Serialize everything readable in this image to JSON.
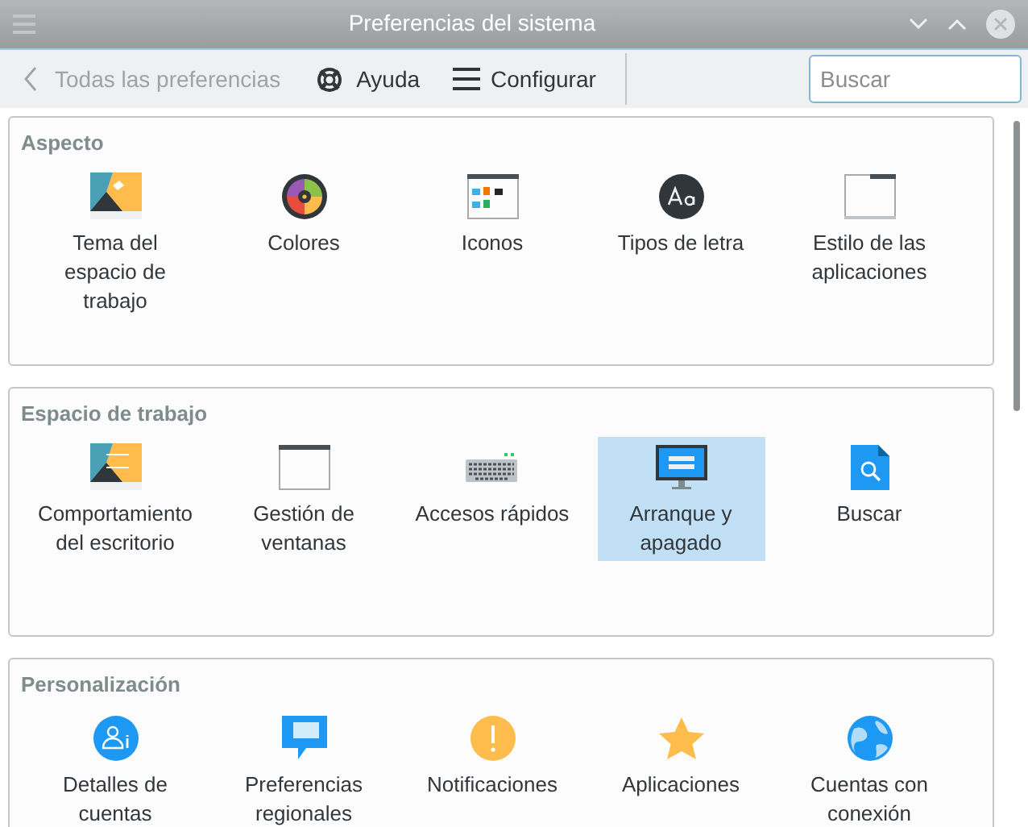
{
  "window": {
    "title": "Preferencias del sistema"
  },
  "toolbar": {
    "back": "Todas las preferencias",
    "help": "Ayuda",
    "configure": "Configurar"
  },
  "search": {
    "placeholder": "Buscar"
  },
  "sections": [
    {
      "title": "Aspecto",
      "items": [
        {
          "label": "Tema del espacio de trabajo",
          "selected": false
        },
        {
          "label": "Colores",
          "selected": false
        },
        {
          "label": "Iconos",
          "selected": false
        },
        {
          "label": "Tipos de letra",
          "selected": false
        },
        {
          "label": "Estilo de las aplicaciones",
          "selected": false
        }
      ]
    },
    {
      "title": "Espacio de trabajo",
      "items": [
        {
          "label": "Comportamiento del escritorio",
          "selected": false
        },
        {
          "label": "Gestión de ventanas",
          "selected": false
        },
        {
          "label": "Accesos rápidos",
          "selected": false
        },
        {
          "label": "Arranque y apagado",
          "selected": true
        },
        {
          "label": "Buscar",
          "selected": false
        }
      ]
    },
    {
      "title": "Personalización",
      "items": [
        {
          "label": "Detalles de cuentas",
          "selected": false
        },
        {
          "label": "Preferencias regionales",
          "selected": false
        },
        {
          "label": "Notificaciones",
          "selected": false
        },
        {
          "label": "Aplicaciones",
          "selected": false
        },
        {
          "label": "Cuentas con conexión",
          "selected": false
        }
      ]
    }
  ]
}
